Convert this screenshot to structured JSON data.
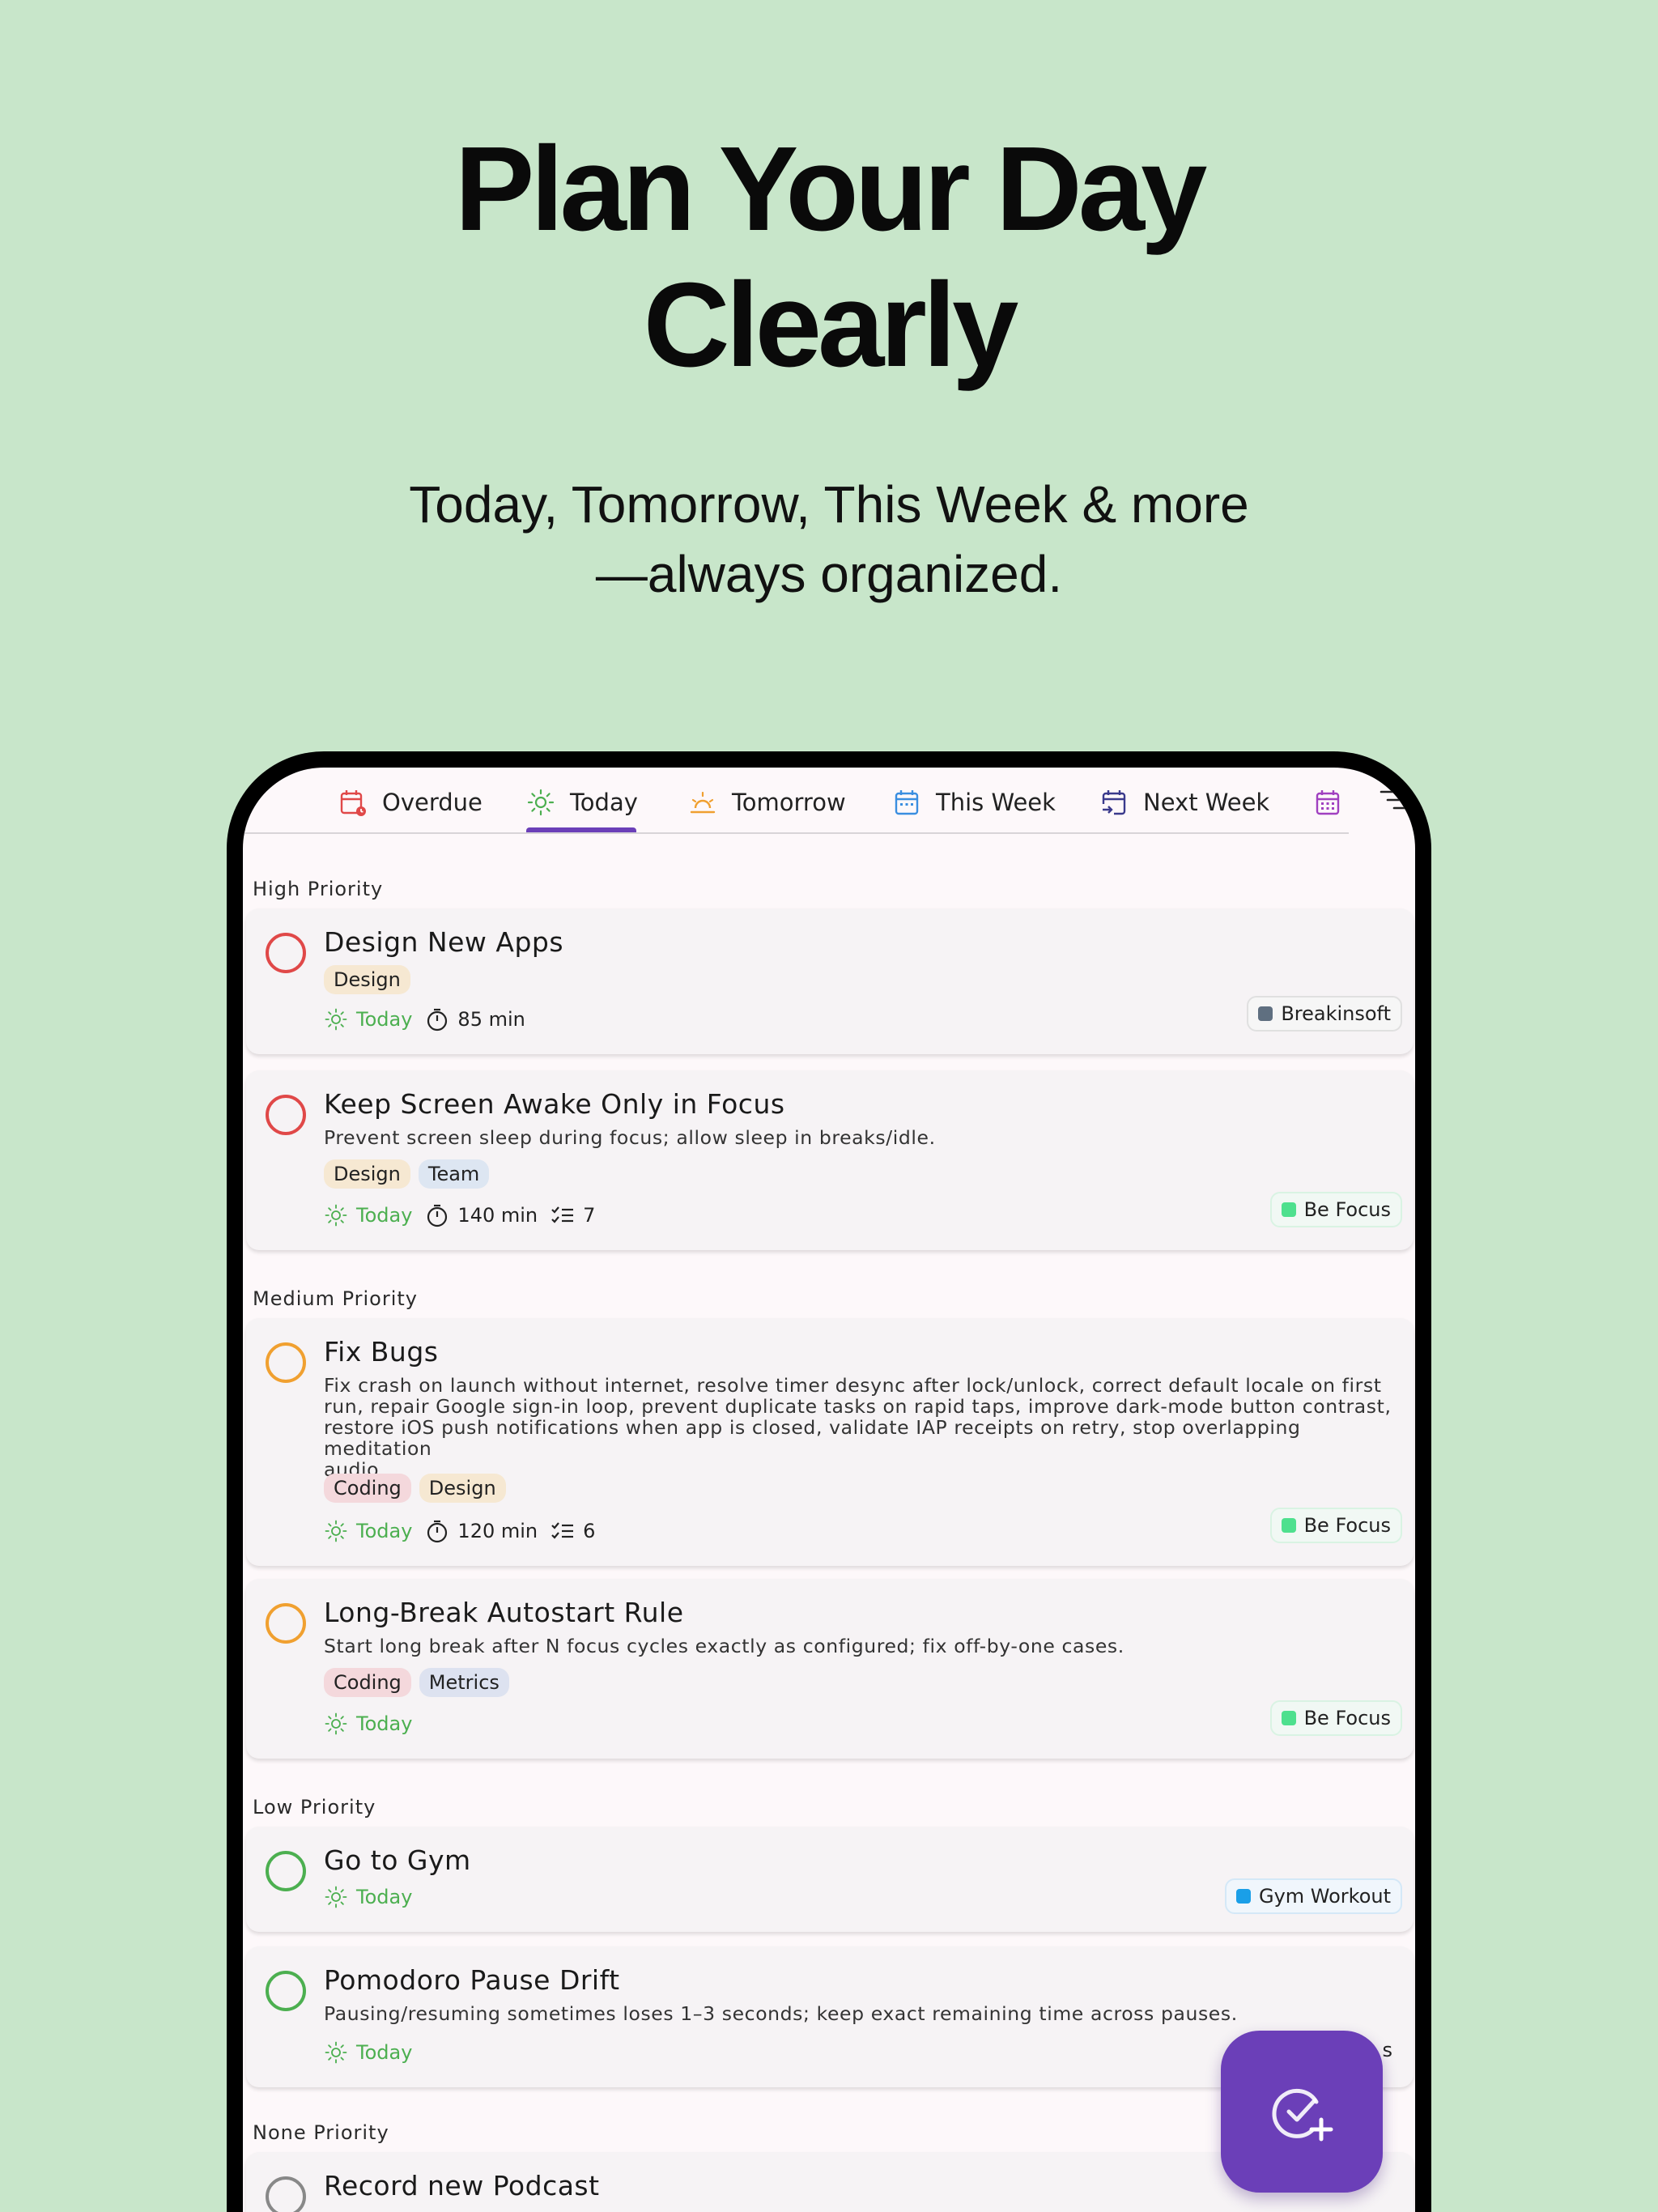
{
  "promo": {
    "headline_line1": "Plan Your Day",
    "headline_line2": "Clearly",
    "subhead_line1": "Today, Tomorrow, This Week & more",
    "subhead_line2": "—always organized."
  },
  "tabs": [
    {
      "label": "Overdue",
      "icon": "calendar-alert-icon",
      "color": "#e04848"
    },
    {
      "label": "Today",
      "icon": "sun-icon",
      "color": "#4caf50",
      "selected": true
    },
    {
      "label": "Tomorrow",
      "icon": "sunrise-icon",
      "color": "#f0a030"
    },
    {
      "label": "This Week",
      "icon": "calendar-icon",
      "color": "#3a8ee0"
    },
    {
      "label": "Next Week",
      "icon": "calendar-next-icon",
      "color": "#3a3a8c"
    },
    {
      "label": "",
      "icon": "calendar-grid-icon",
      "color": "#a040c0"
    }
  ],
  "accent": "#6b3fb8",
  "sections": {
    "high": "High Priority",
    "medium": "Medium Priority",
    "low": "Low Priority",
    "none": "None Priority"
  },
  "tasks": [
    {
      "title": "Design New Apps",
      "tags": [
        "Design"
      ],
      "due": "Today",
      "duration": "85 min",
      "project": "Breakinsoft"
    },
    {
      "title": "Keep Screen Awake Only in Focus",
      "desc": "Prevent screen sleep during focus; allow sleep in breaks/idle.",
      "tags": [
        "Design",
        "Team"
      ],
      "due": "Today",
      "duration": "140 min",
      "subtasks": "7",
      "project": "Be Focus"
    },
    {
      "title": "Fix Bugs",
      "desc_lines": [
        "Fix crash on launch without internet, resolve timer desync after lock/unlock, correct default locale on first",
        "run, repair Google sign-in loop, prevent duplicate tasks on rapid taps, improve dark-mode button contrast,",
        "restore iOS push notifications when app is closed, validate IAP receipts on retry, stop overlapping meditation",
        "audio."
      ],
      "tags": [
        "Coding",
        "Design"
      ],
      "due": "Today",
      "duration": "120 min",
      "subtasks": "6",
      "project": "Be Focus"
    },
    {
      "title": "Long-Break Autostart Rule",
      "desc": "Start long break after N focus cycles exactly as configured; fix off-by-one cases.",
      "tags": [
        "Coding",
        "Metrics"
      ],
      "due": "Today",
      "project": "Be Focus"
    },
    {
      "title": "Go to Gym",
      "due": "Today",
      "project": "Gym Workout"
    },
    {
      "title": "Pomodoro Pause Drift",
      "desc": "Pausing/resuming sometimes loses 1–3 seconds; keep exact remaining time across pauses.",
      "due": "Today",
      "project_partial": "s"
    },
    {
      "title": "Record new Podcast"
    }
  ],
  "project_colors": {
    "Breakinsoft": "#5f6f80",
    "Be Focus": "#4ee08e",
    "Gym Workout": "#1a9fe8"
  },
  "fab": {
    "icon": "add-task-icon"
  }
}
